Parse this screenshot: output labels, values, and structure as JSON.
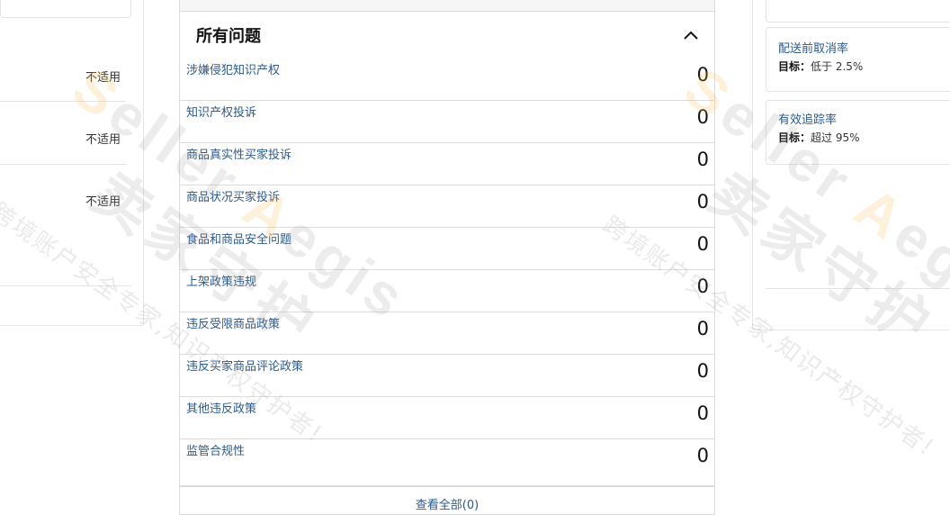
{
  "left": {
    "not_applicable": [
      "不适用",
      "不适用",
      "不适用"
    ]
  },
  "issues_section": {
    "title": "所有问题",
    "items": [
      {
        "label": "涉嫌侵犯知识产权",
        "count": "0"
      },
      {
        "label": "知识产权投诉",
        "count": "0"
      },
      {
        "label": "商品真实性买家投诉",
        "count": "0"
      },
      {
        "label": "商品状况买家投诉",
        "count": "0"
      },
      {
        "label": "食品和商品安全问题",
        "count": "0"
      },
      {
        "label": "上架政策违规",
        "count": "0"
      },
      {
        "label": "违反受限商品政策",
        "count": "0"
      },
      {
        "label": "违反买家商品评论政策",
        "count": "0"
      },
      {
        "label": "其他违反政策",
        "count": "0"
      },
      {
        "label": "监管合规性",
        "count": "0"
      }
    ],
    "view_all": "查看全部(0)"
  },
  "right": {
    "metrics": [
      {
        "title": "配送前取消率",
        "target_label": "目标：",
        "target_value": "低于 2.5%"
      },
      {
        "title": "有效追踪率",
        "target_label": "目标：",
        "target_value": "超过 95%"
      }
    ]
  },
  "watermark": {
    "brand_en": "Seller Aegis",
    "brand_cn": "卖家守护",
    "slogan": "跨境账户安全专家,知识产权守护者!"
  }
}
